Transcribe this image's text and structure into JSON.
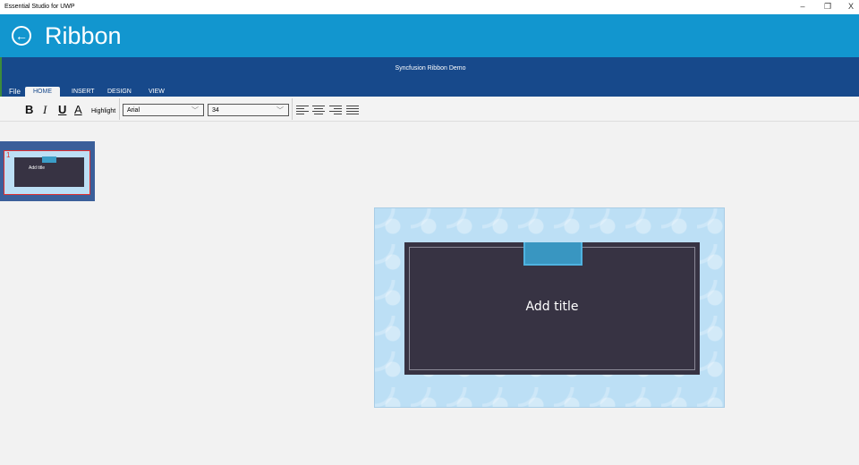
{
  "window": {
    "title": "Essential Studio for UWP",
    "minimize": "–",
    "restore": "❐",
    "close": "X"
  },
  "header": {
    "back_icon": "arrow-left-circle",
    "title": "Ribbon"
  },
  "ribbon": {
    "title": "Syncfusion Ribbon Demo",
    "tabs": [
      {
        "label": "File"
      },
      {
        "label": "HOME",
        "selected": true
      },
      {
        "label": "INSERT"
      },
      {
        "label": "DESIGN"
      },
      {
        "label": "VIEW"
      }
    ],
    "home": {
      "bold": "B",
      "italic": "I",
      "underline": "U",
      "font_color": "A",
      "highlight": "Highlight",
      "font_family": "Arial",
      "font_size": "34"
    }
  },
  "colors": {
    "header": "#1296cf",
    "ribbon": "#17498b",
    "slide_bg": "#bcdff5",
    "slide_box": "#373343"
  },
  "thumbnails": [
    {
      "number": "1",
      "title": "Add title",
      "selected": true
    }
  ],
  "slide": {
    "title": "Add title"
  }
}
